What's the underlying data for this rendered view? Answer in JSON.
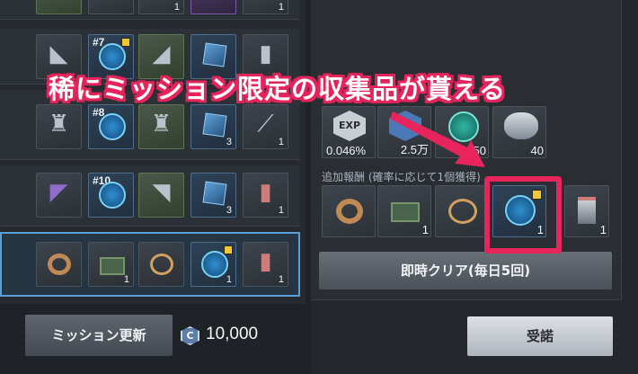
{
  "annotation": {
    "text": "稀にミッション限定の収集品が貰える",
    "color": "#e6245c"
  },
  "mission_rows": [
    {
      "slots": [
        {
          "icon": "green-crate-icon",
          "qty": ""
        },
        {
          "icon": "armor-piece-icon",
          "qty": "1"
        },
        {
          "icon": "purple-cube-icon",
          "qty": ""
        },
        {
          "icon": "gear-part-icon",
          "qty": "1"
        }
      ]
    },
    {
      "slots": [
        {
          "icon": "armor-collar-icon",
          "qty": "",
          "tag": ""
        },
        {
          "icon": "trading-card-icon",
          "qty": "",
          "tag": "#7",
          "badge": true
        },
        {
          "icon": "armor-collar-icon",
          "qty": ""
        },
        {
          "icon": "blue-cube-icon",
          "qty": ""
        },
        {
          "icon": "canister-icon",
          "qty": ""
        }
      ]
    },
    {
      "slots": [
        {
          "icon": "chest-armor-icon",
          "qty": ""
        },
        {
          "icon": "trading-card-icon",
          "qty": "",
          "tag": "#8"
        },
        {
          "icon": "chest-armor-icon",
          "qty": ""
        },
        {
          "icon": "blue-cube-icon",
          "qty": "3"
        },
        {
          "icon": "cable-icon",
          "qty": "1"
        }
      ]
    },
    {
      "slots": [
        {
          "icon": "arm-armor-icon",
          "qty": ""
        },
        {
          "icon": "trading-card-icon",
          "qty": "",
          "tag": "#10"
        },
        {
          "icon": "arm-armor-icon",
          "qty": ""
        },
        {
          "icon": "blue-cube-icon",
          "qty": "3"
        },
        {
          "icon": "canister-icon",
          "qty": "1"
        }
      ]
    },
    {
      "slots": [
        {
          "icon": "ring-icon",
          "qty": ""
        },
        {
          "icon": "supply-box-icon",
          "qty": "1"
        },
        {
          "icon": "bracelet-icon",
          "qty": ""
        },
        {
          "icon": "emblem-icon",
          "qty": "1",
          "badge": true
        },
        {
          "icon": "canister-icon",
          "qty": "1"
        }
      ]
    }
  ],
  "rewards": {
    "main": [
      {
        "icon": "exp-icon",
        "label": "EXP",
        "value": "0.046%"
      },
      {
        "icon": "credit-icon",
        "label": "",
        "value": "2.5万"
      },
      {
        "icon": "token-icon",
        "label": "",
        "value": "50"
      },
      {
        "icon": "coin-icon",
        "label": "",
        "value": "40"
      }
    ],
    "extra_label": "追加報酬 (確率に応じて1個獲得)",
    "extra": [
      {
        "icon": "ring-icon",
        "value": ""
      },
      {
        "icon": "supply-box-icon",
        "value": "1"
      },
      {
        "icon": "bracelet-icon",
        "value": ""
      },
      {
        "icon": "emblem-icon",
        "value": "1",
        "badge": true
      },
      {
        "icon": "canister-icon",
        "value": "1"
      }
    ]
  },
  "buttons": {
    "instant_clear": "即時クリア(毎日5回)",
    "mission_update": "ミッション更新",
    "accept": "受諾"
  },
  "currency": {
    "icon_letter": "C",
    "value": "10,000"
  }
}
